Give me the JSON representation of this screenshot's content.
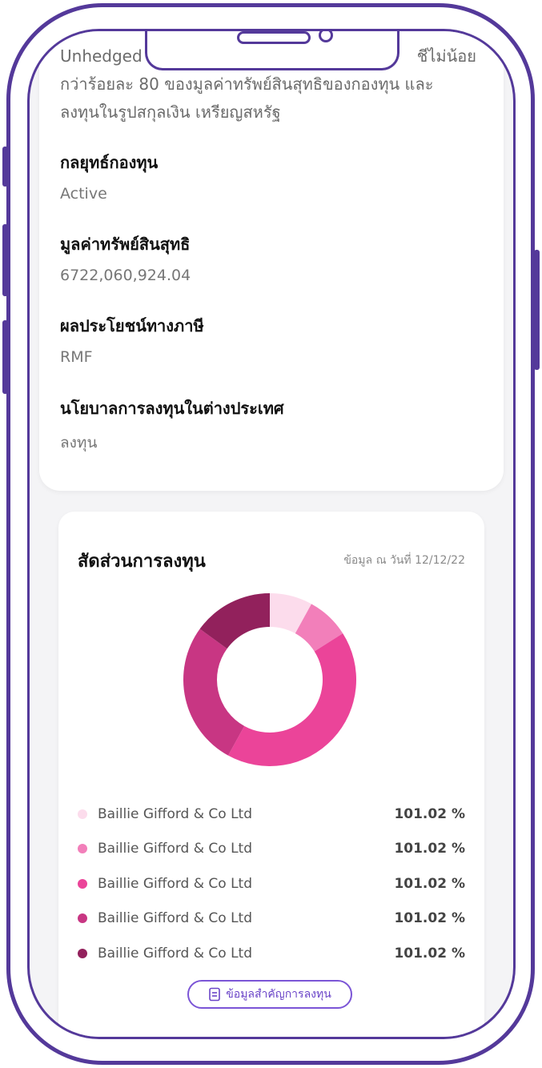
{
  "fund": {
    "description": "Unhedged ลงทุนในกองทุนต่างประเทศ เฉลี่ยในรอบปีบัญชีไม่น้อยกว่าร้อยละ 80 ของมูลค่าทรัพย์สินสุทธิของกองทุน และลงทุนในรูปสกุลเงิน เหรียญสหรัฐ",
    "desc_line1_left": "Unhedged",
    "desc_line1_right": "ชีไม่น้อย",
    "desc_line2": "กว่าร้อยละ 80 ของมูลค่าทรัพย์สินสุทธิของกองทุน และ",
    "desc_line3": "ลงทุนในรูปสกุลเงิน เหรียญสหรัฐ",
    "fields": [
      {
        "label": "กลยุทธ์กองทุน",
        "value": "Active"
      },
      {
        "label": "มูลค่าทรัพย์สินสุทธิ",
        "value": "6722,060,924.04"
      },
      {
        "label": "ผลประโยชน์ทางภาษี",
        "value": "RMF"
      },
      {
        "label": "นโยบาลการลงทุนในต่างประเทศ",
        "value": "ลงทุน"
      }
    ]
  },
  "allocation": {
    "title": "สัดส่วนการลงทุน",
    "date": "ข้อมูล ณ วันที่ 12/12/22",
    "button_label": "ข้อมูลสำคัญการลงทุน",
    "button_icon": "document-icon",
    "items": [
      {
        "name": "Baillie Gifford & Co Ltd",
        "value": "101.02 %",
        "color": "#fcdcec"
      },
      {
        "name": "Baillie Gifford & Co Ltd",
        "value": "101.02 %",
        "color": "#f27fba"
      },
      {
        "name": "Baillie Gifford & Co Ltd",
        "value": "101.02 %",
        "color": "#eb4499"
      },
      {
        "name": "Baillie Gifford & Co Ltd",
        "value": "101.02 %",
        "color": "#c83683"
      },
      {
        "name": "Baillie Gifford & Co Ltd",
        "value": "101.02 %",
        "color": "#92215c"
      }
    ]
  },
  "chart_data": {
    "type": "pie",
    "categories": [
      "Baillie Gifford & Co Ltd",
      "Baillie Gifford & Co Ltd",
      "Baillie Gifford & Co Ltd",
      "Baillie Gifford & Co Ltd",
      "Baillie Gifford & Co Ltd"
    ],
    "values": [
      8,
      8,
      42,
      27,
      15
    ],
    "colors": [
      "#fcdcec",
      "#f27fba",
      "#eb4499",
      "#c83683",
      "#92215c"
    ],
    "title": "สัดส่วนการลงทุน",
    "donut": true
  }
}
